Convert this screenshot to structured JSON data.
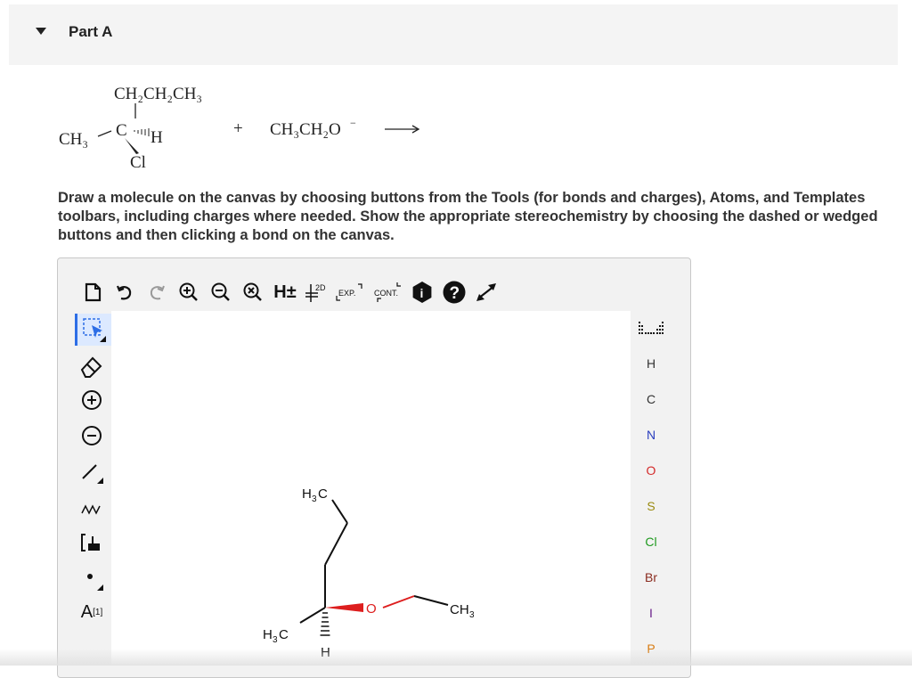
{
  "part": {
    "title": "Part A"
  },
  "reaction": {
    "top_group": "CH₂CH₂CH₃",
    "left_group": "CH₃",
    "center": "C",
    "right_group": "H",
    "bottom_group": "Cl",
    "plus": "+",
    "reagent": "CH₃CH₂O",
    "reagent_charge": "−",
    "arrow": "⟶"
  },
  "instructions": "Draw a molecule on the canvas by choosing buttons from the Tools (for bonds and charges), Atoms, and Templates toolbars, including charges where needed.  Show the appropriate stereochemistry by choosing the dashed or wedged buttons and then clicking a bond on the canvas.",
  "toolbar": {
    "hplus": "H±",
    "exp": "EXP.",
    "cont": "CONT.",
    "two_d": "2D",
    "info": "i",
    "help": "?"
  },
  "left_tools": {
    "atom_map": "A",
    "atom_map_index": "[1]"
  },
  "atoms": [
    {
      "symbol": "H",
      "color": "#333333"
    },
    {
      "symbol": "C",
      "color": "#333333"
    },
    {
      "symbol": "N",
      "color": "#2b3fbf"
    },
    {
      "symbol": "O",
      "color": "#d42a2a"
    },
    {
      "symbol": "S",
      "color": "#9a8a10"
    },
    {
      "symbol": "Cl",
      "color": "#1f9a1f"
    },
    {
      "symbol": "Br",
      "color": "#8a2b1f"
    },
    {
      "symbol": "I",
      "color": "#6a1f8a"
    },
    {
      "symbol": "P",
      "color": "#d87a10"
    }
  ],
  "molecule": {
    "top_label": "H",
    "top_sub": "3",
    "top_c": "C",
    "left_label": "H",
    "left_sub": "3",
    "left_c": "C",
    "oxygen": "O",
    "right_label": "CH",
    "right_sub": "3",
    "hydrogen": "H"
  }
}
